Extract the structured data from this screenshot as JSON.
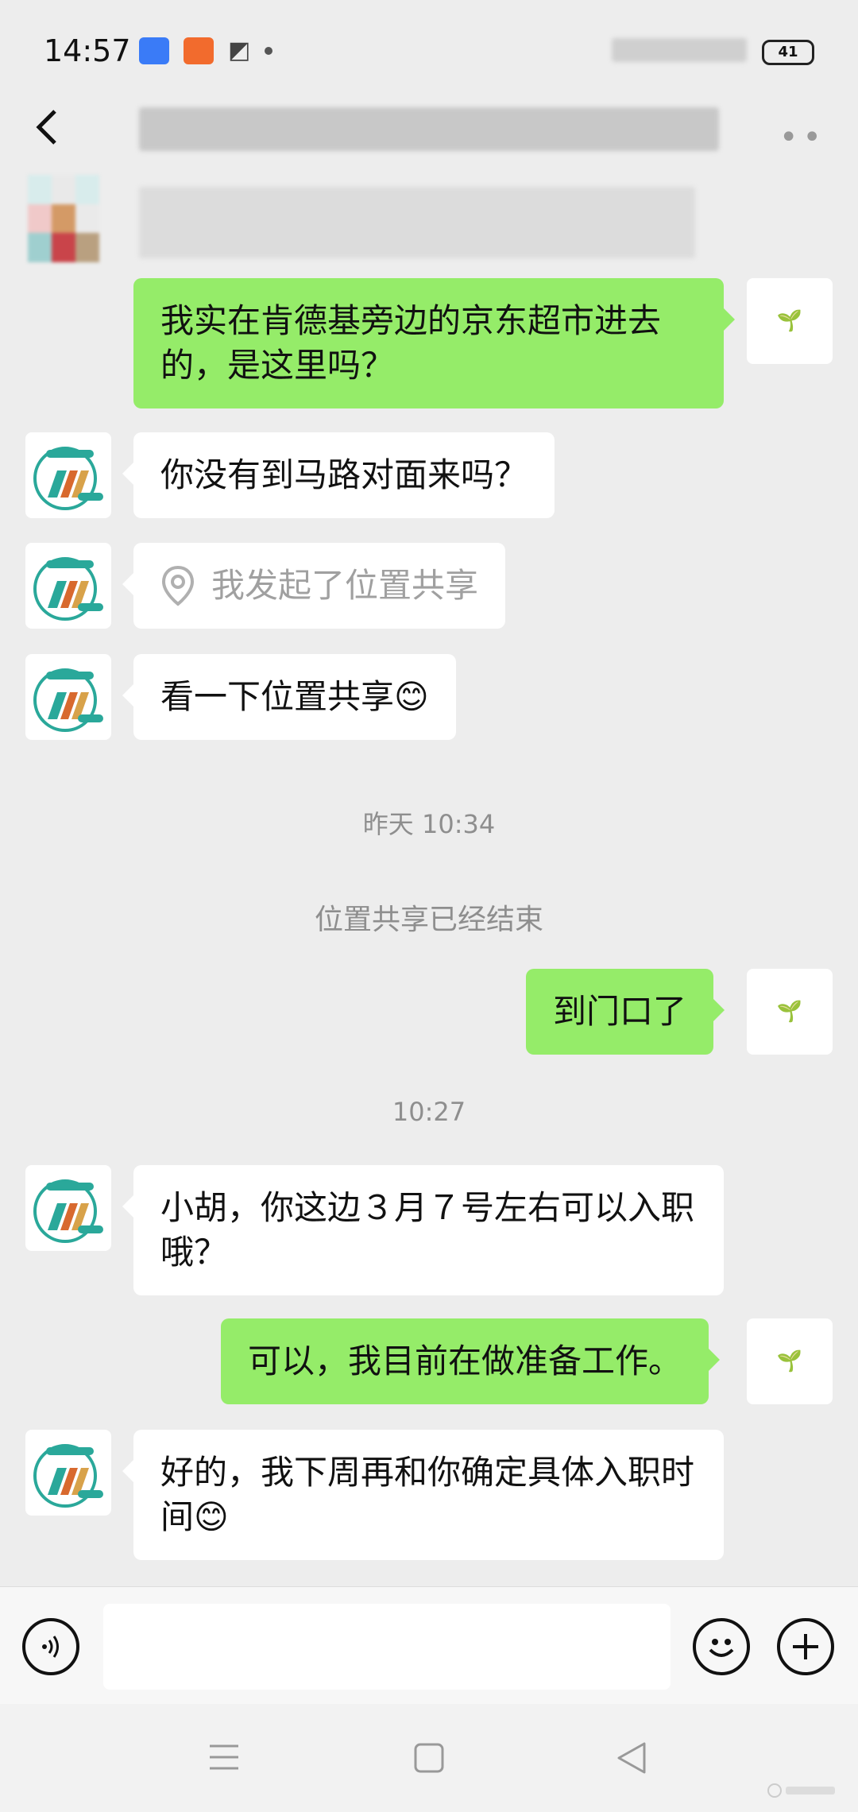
{
  "status_bar": {
    "time": "14:57",
    "battery": "41"
  },
  "messages": [
    {
      "text": "我实在肯德基旁边的京东超市进去的，是这里吗？"
    },
    {
      "text": "你没有到马路对面来吗？"
    },
    {
      "text": "我发起了位置共享"
    },
    {
      "text": "看一下位置共享😊"
    },
    {
      "timestamp": "昨天 10:34"
    },
    {
      "system": "位置共享已经结束"
    },
    {
      "text": "到门口了"
    },
    {
      "timestamp": "10:27"
    },
    {
      "text": "小胡，你这边３月７号左右可以入职哦？"
    },
    {
      "text": "可以，我目前在做准备工作。"
    },
    {
      "text": "好的，我下周再和你确定具体入职时间😊"
    }
  ],
  "icons": {
    "back": "chevron-left-icon",
    "more": "more-dots-icon",
    "voice": "voice-icon",
    "emoji": "emoji-icon",
    "plus": "plus-icon",
    "location": "location-pin-icon",
    "sprout": "sprout-icon"
  },
  "colors": {
    "mine_bubble": "#95ec69",
    "other_bubble": "#ffffff",
    "background": "#ededed"
  }
}
